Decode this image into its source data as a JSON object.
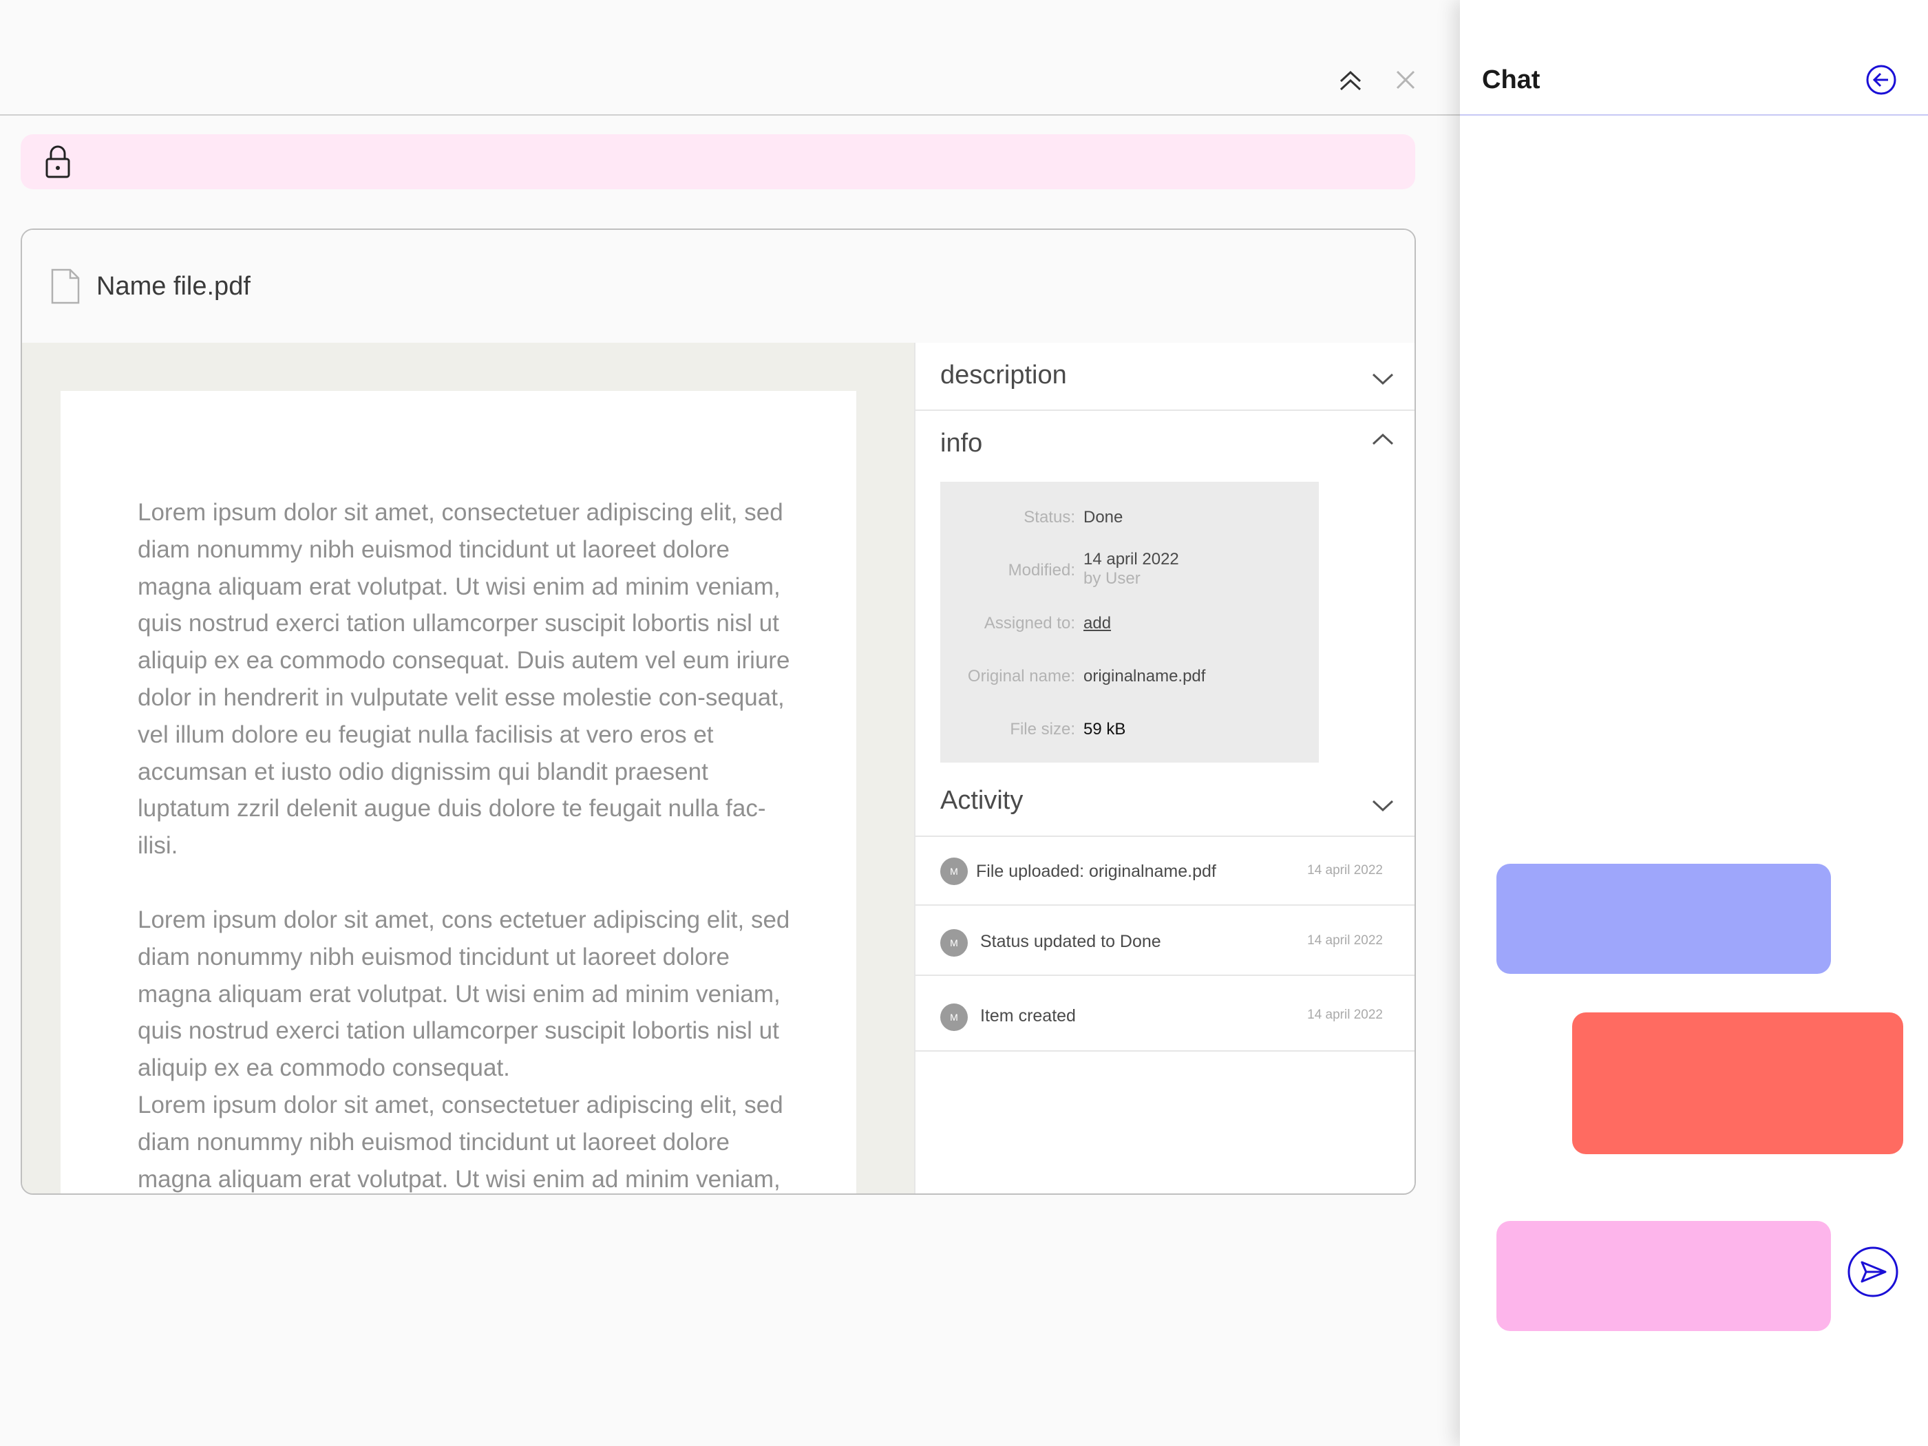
{
  "toolbar": {
    "collapse_icon": "double-chevron-up-icon",
    "close_icon": "close-icon"
  },
  "banner": {
    "icon": "lock-icon",
    "color": "#ffe8f6"
  },
  "file": {
    "icon": "file-icon",
    "name": "Name file.pdf"
  },
  "preview": {
    "paragraphs": [
      "Lorem ipsum dolor sit amet, consectetuer adipiscing elit, sed diam nonummy nibh euismod tincidunt ut laoreet dolore magna aliquam erat volutpat. Ut wisi enim ad minim veniam, quis nostrud exerci tation ullamcorper suscipit lobortis nisl ut aliquip ex ea commodo consequat. Duis autem vel eum iriure dolor in hendrerit in vulputate velit esse molestie con-sequat, vel illum dolore eu feugiat nulla facilisis at vero eros et accumsan et iusto odio dignissim qui blandit praesent luptatum zzril delenit augue duis dolore te feugait nulla fac-ilisi.",
      "Lorem ipsum dolor sit amet, cons ectetuer adipiscing elit, sed diam nonummy nibh euismod tincidunt ut laoreet dolore magna aliquam erat volutpat. Ut wisi enim ad minim veniam, quis nostrud exerci tation ullamcorper suscipit lobortis nisl ut aliquip ex ea commodo consequat.",
      "Lorem ipsum dolor sit amet, consectetuer adipiscing elit, sed diam nonummy nibh euismod tincidunt ut laoreet dolore magna aliquam erat volutpat. Ut wisi enim ad minim veniam,"
    ]
  },
  "sidepanel": {
    "description": {
      "title": "description",
      "state": "collapsed"
    },
    "info": {
      "title": "info",
      "state": "expanded",
      "status_label": "Status:",
      "status_value": "Done",
      "modified_label": "Modified:",
      "modified_date": "14 april 2022",
      "modified_by": "by User",
      "assigned_label": "Assigned to:",
      "assigned_value": "add",
      "original_label": "Original name:",
      "original_value": "originalname.pdf",
      "size_label": "File size:",
      "size_value": "59 kB"
    },
    "activity": {
      "title": "Activity",
      "state": "collapsed",
      "items": [
        {
          "avatar": "M",
          "text": "File uploaded: originalname.pdf",
          "date": "14 april 2022"
        },
        {
          "avatar": "M",
          "text": "Status updated to Done",
          "date": "14 april 2022"
        },
        {
          "avatar": "M",
          "text": "Item created",
          "date": "14 april 2022"
        }
      ]
    }
  },
  "chat": {
    "title": "Chat",
    "back_icon": "arrow-left-circle-icon",
    "send_icon": "send-icon",
    "accent": "#1a0fd6",
    "bubbles": [
      {
        "color": "#9ea6fb"
      },
      {
        "color": "#ff6b61"
      },
      {
        "color": "#fdb5eb"
      }
    ]
  }
}
